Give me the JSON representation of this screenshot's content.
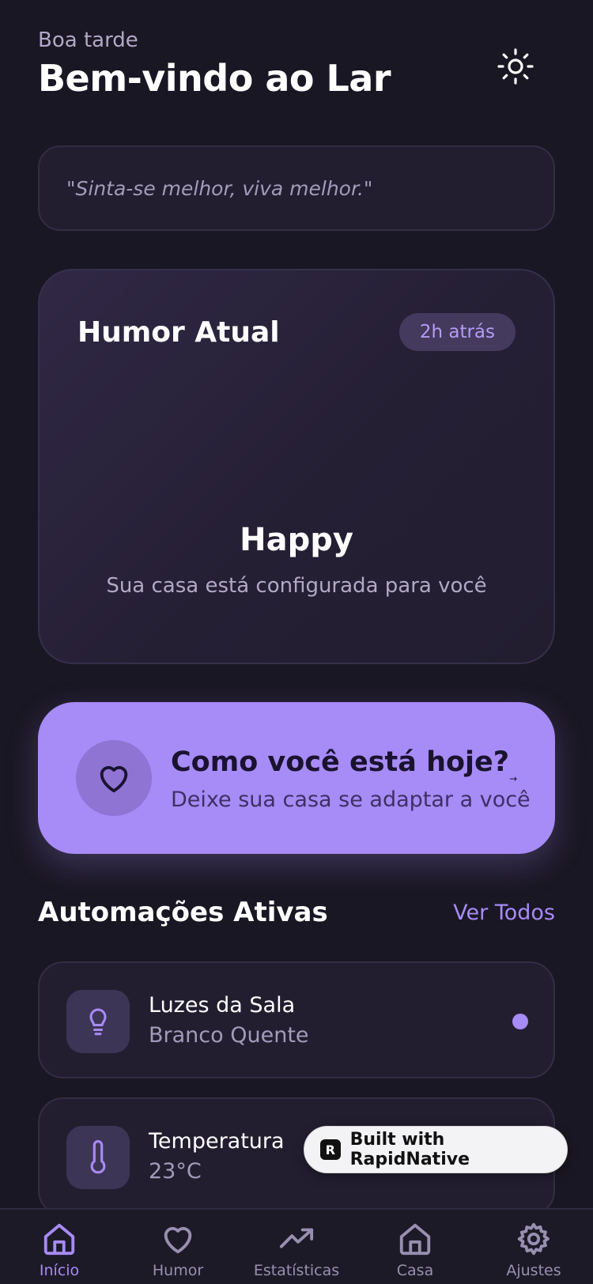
{
  "header": {
    "greeting": "Boa tarde",
    "title": "Bem-vindo ao Lar",
    "theme_icon": "sun-icon"
  },
  "quote": {
    "text": "\"Sinta-se melhor, viva melhor.\""
  },
  "mood": {
    "title": "Humor Atual",
    "badge": "2h atrás",
    "value": "Happy",
    "description": "Sua casa está configurada para você"
  },
  "checkin": {
    "title": "Como você está hoje?",
    "subtitle": "Deixe sua casa se adaptar a você",
    "arrow": "→",
    "icon": "heart-icon"
  },
  "automations": {
    "title": "Automações Ativas",
    "see_all": "Ver Todos",
    "items": [
      {
        "name": "Luzes da Sala",
        "value": "Branco Quente",
        "icon": "lightbulb-icon",
        "active": true
      },
      {
        "name": "Temperatura",
        "value": "23°C",
        "icon": "thermometer-icon"
      }
    ]
  },
  "built_badge": {
    "text": "Built with RapidNative",
    "logo": "R"
  },
  "tabs": [
    {
      "label": "Início",
      "icon": "home-icon",
      "active": true
    },
    {
      "label": "Humor",
      "icon": "heart-icon"
    },
    {
      "label": "Estatísticas",
      "icon": "trending-up-icon"
    },
    {
      "label": "Casa",
      "icon": "house-icon"
    },
    {
      "label": "Ajustes",
      "icon": "gear-icon"
    }
  ],
  "colors": {
    "background": "#1a1724",
    "card": "#221e30",
    "accent": "#a78bf6",
    "muted_text": "#a39bb9"
  }
}
